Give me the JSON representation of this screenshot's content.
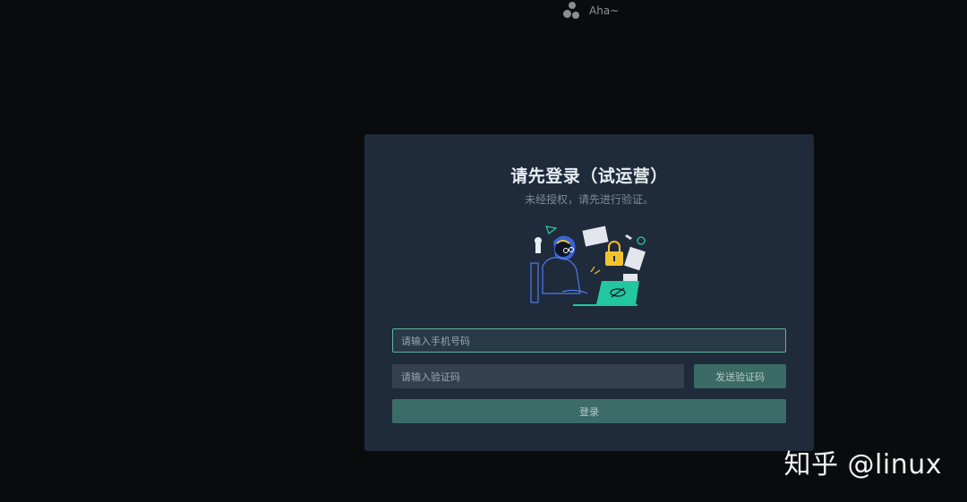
{
  "header": {
    "app_name": "Aha~",
    "logo_icon": "three-dots-logo-icon"
  },
  "login": {
    "title": "请先登录（试运营）",
    "subtitle": "未经授权，请先进行验证。",
    "phone_placeholder": "请输入手机号码",
    "code_placeholder": "请输入验证码",
    "send_code_label": "发送验证码",
    "login_label": "登录"
  },
  "watermark": {
    "text": "知乎 @linux"
  },
  "colors": {
    "background": "#0a0b0d",
    "card": "#1f2a3b",
    "accent": "#3c6c68",
    "focus_border": "#5eb39c"
  }
}
